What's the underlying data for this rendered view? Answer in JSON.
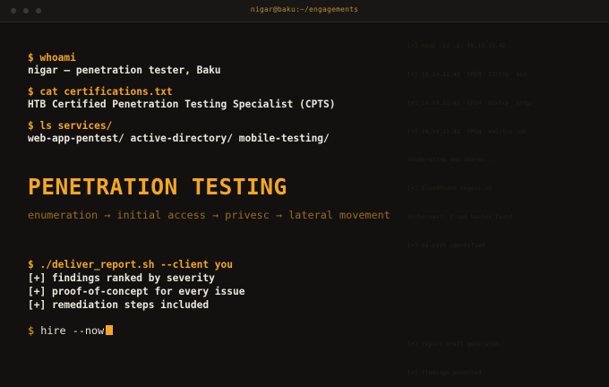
{
  "window": {
    "title": "nigar@baku:~/engagements"
  },
  "terminal": {
    "blocks": [
      {
        "command": "$ whoami",
        "output": "nigar — penetration tester, Baku"
      },
      {
        "command": "$ cat certifications.txt",
        "output": "HTB Certified Penetration Testing Specialist (CPTS)"
      },
      {
        "command": "$ ls services/",
        "output": "web-app-pentest/ active-directory/ mobile-testing/"
      }
    ],
    "headline": "PENETRATION TESTING",
    "flow": "enumeration → initial access → privesc → lateral movement",
    "report": {
      "command": "$ ./deliver_report.sh --client you",
      "items": [
        "[+] findings ranked by severity",
        "[+] proof-of-concept for every issue",
        "[+] remediation steps included"
      ]
    },
    "final_prompt": {
      "symbol": "$",
      "command": "hire --now"
    }
  },
  "background_log": {
    "top": [
      "[+] nmap -sV -p- 10.10.11.42",
      "[+] 10.10.11.42  OPEN  22/tcp  ssh",
      "[+] 10.10.11.42  OPEN  80/tcp  http",
      "[+] 10.10.11.42  OPEN  445/tcp smb",
      "enumerating smb shares...",
      "[+] bloodhound ingest ok",
      "kerberoast: 2 spn hashes found",
      "[+] da path identified"
    ],
    "bottom": [
      "[+] report draft generated",
      "[+] findings exported"
    ]
  },
  "colors": {
    "accent": "#f5a623",
    "muted_accent": "#9c6a22",
    "text": "#ece6da",
    "background": "#121110"
  }
}
